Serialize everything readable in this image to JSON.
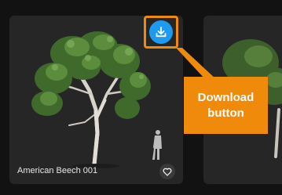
{
  "asset_card": {
    "title": "American Beech 001",
    "download_icon": "download-tray-icon",
    "favorite_icon": "heart-outline-icon"
  },
  "annotation": {
    "callout_text": "Download button",
    "highlight_color": "#f08a0a"
  },
  "colors": {
    "background": "#121212",
    "card": "#262626",
    "download_button": "#1e9bf0",
    "callout": "#f08a0a"
  }
}
